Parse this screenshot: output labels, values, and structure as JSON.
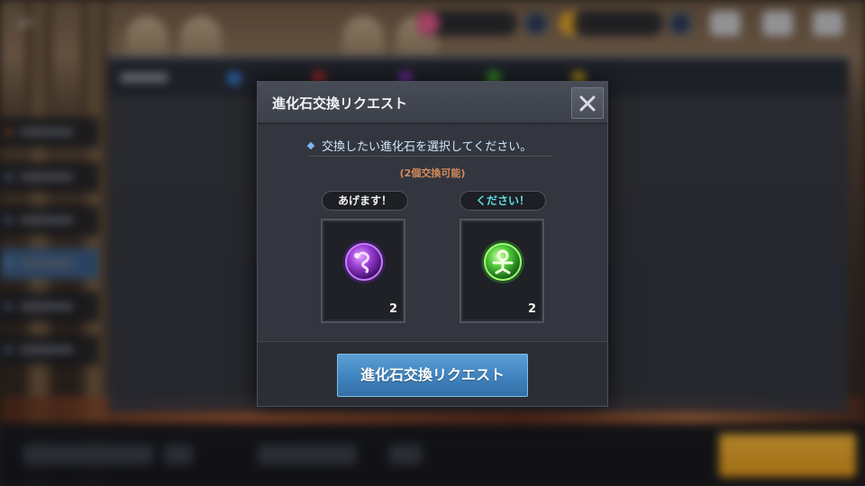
{
  "modal": {
    "title": "進化石交換リクエスト",
    "instruction": "交換したい進化石を選択してください。",
    "subnote": "(2個交換可能)",
    "give": {
      "label": "あげます！",
      "count": "2",
      "icon": "purple-evolution-stone-icon"
    },
    "want": {
      "label": "ください！",
      "count": "2",
      "icon": "green-evolution-stone-icon"
    },
    "submit_label": "進化石交換リクエスト"
  },
  "colors": {
    "accent_blue": "#4a8fcb",
    "want_label": "#5ee0e6",
    "subnote": "#d38c5a",
    "purple_stone": "#9b3fd6",
    "green_stone": "#4fc93a"
  }
}
